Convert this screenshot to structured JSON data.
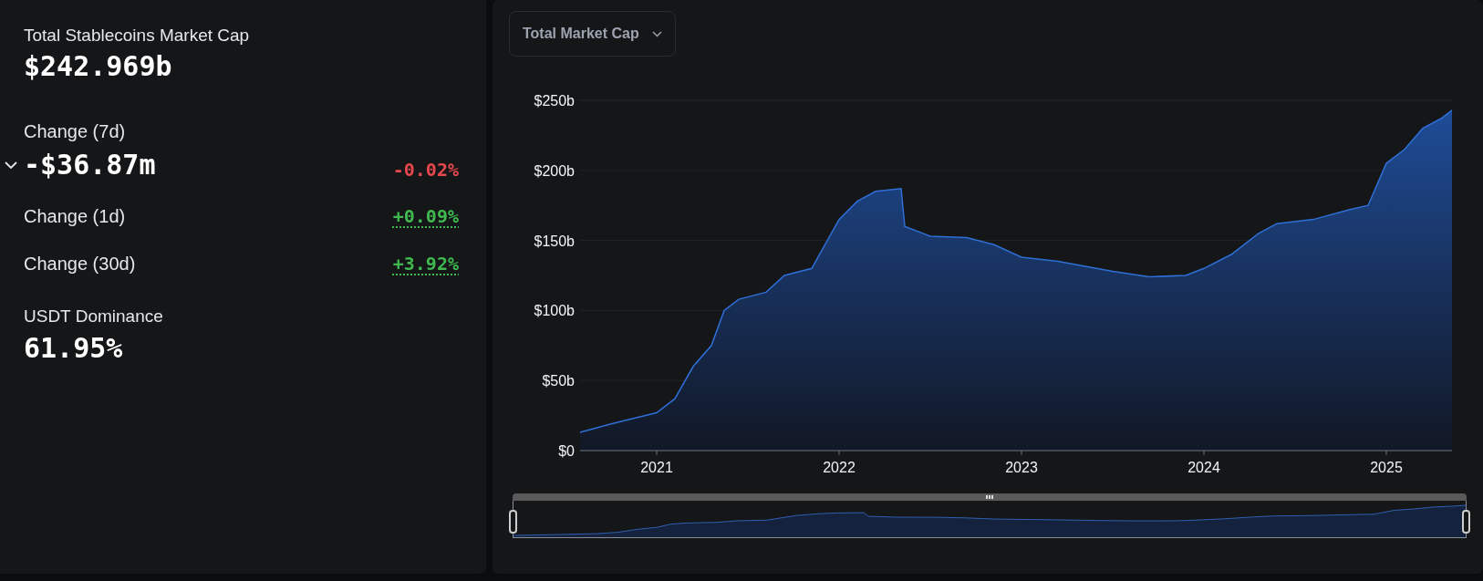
{
  "summary": {
    "title": "Total Stablecoins Market Cap",
    "value": "$242.969b"
  },
  "changes": [
    {
      "kind": "main",
      "label": "Change (7d)",
      "value": "-$36.87m",
      "percent": "-0.02%",
      "color": "#e5484d",
      "expanded": false
    },
    {
      "kind": "minor",
      "label": "Change (1d)",
      "percent": "+0.09%",
      "color": "#3fb950"
    },
    {
      "kind": "minor",
      "label": "Change (30d)",
      "percent": "+3.92%",
      "color": "#3fb950"
    }
  ],
  "dominance": {
    "label": "USDT Dominance",
    "value": "61.95%"
  },
  "chart": {
    "selector": "Total Market Cap",
    "chart_data": {
      "type": "area",
      "grid": true,
      "x": [
        2020.58,
        2020.75,
        2021.0,
        2021.1,
        2021.2,
        2021.3,
        2021.37,
        2021.45,
        2021.6,
        2021.7,
        2021.85,
        2022.0,
        2022.1,
        2022.2,
        2022.34,
        2022.36,
        2022.5,
        2022.7,
        2022.85,
        2023.0,
        2023.2,
        2023.5,
        2023.7,
        2023.9,
        2024.0,
        2024.15,
        2024.3,
        2024.4,
        2024.6,
        2024.8,
        2024.9,
        2025.0,
        2025.1,
        2025.2,
        2025.3,
        2025.36
      ],
      "series": [
        {
          "color": "#2f6fd6",
          "values": [
            13,
            19,
            27,
            37,
            60,
            75,
            100,
            108,
            113,
            125,
            130,
            165,
            178,
            185,
            187,
            160,
            153,
            152,
            147,
            138,
            135,
            128,
            124,
            125,
            130,
            140,
            155,
            162,
            165,
            172,
            175,
            205,
            215,
            230,
            237,
            243
          ]
        }
      ],
      "xlim": [
        2020.58,
        2025.36
      ],
      "ylim": [
        0,
        250
      ],
      "xticks": [
        {
          "value": 2021,
          "label": "2021"
        },
        {
          "value": 2022,
          "label": "2022"
        },
        {
          "value": 2023,
          "label": "2023"
        },
        {
          "value": 2024,
          "label": "2024"
        },
        {
          "value": 2025,
          "label": "2025"
        }
      ],
      "yticks": [
        {
          "value": 0,
          "label": "$0"
        },
        {
          "value": 50,
          "label": "$50b"
        },
        {
          "value": 100,
          "label": "$100b"
        },
        {
          "value": 150,
          "label": "$150b"
        },
        {
          "value": 200,
          "label": "$200b"
        },
        {
          "value": 250,
          "label": "$250b"
        }
      ]
    }
  }
}
